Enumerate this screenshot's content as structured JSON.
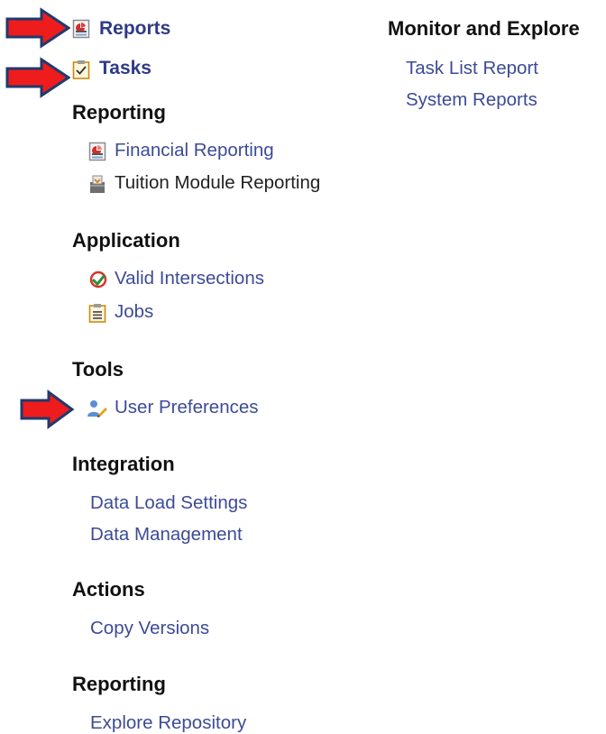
{
  "top_links": {
    "reports": "Reports",
    "tasks": "Tasks"
  },
  "sections": {
    "reporting": {
      "heading": "Reporting",
      "items": [
        "Financial Reporting",
        "Tuition Module Reporting"
      ]
    },
    "application": {
      "heading": "Application",
      "items": [
        "Valid Intersections",
        "Jobs"
      ]
    },
    "tools": {
      "heading": "Tools",
      "items": [
        "User Preferences"
      ]
    },
    "integration": {
      "heading": "Integration",
      "items": [
        "Data Load Settings",
        "Data Management"
      ]
    },
    "actions": {
      "heading": "Actions",
      "items": [
        "Copy Versions"
      ]
    },
    "reporting2": {
      "heading": "Reporting",
      "items": [
        "Explore Repository"
      ]
    },
    "monitor": {
      "heading": "Monitor and Explore",
      "items": [
        "Task List Report",
        "System Reports"
      ]
    }
  },
  "icons": {
    "reports": "report-icon",
    "tasks": "clipboard-check-icon",
    "financial_reporting": "report-icon",
    "tuition_module_reporting": "tray-inbox-icon",
    "valid_intersections": "check-circle-icon",
    "jobs": "clipboard-list-icon",
    "user_preferences": "user-edit-icon",
    "annotation_arrow": "red-arrow-icon"
  },
  "colors": {
    "link": "#3d4b96",
    "top_link": "#2f3a86",
    "heading": "#111111",
    "arrow_fill": "#ee1c1c",
    "arrow_stroke": "#1f3a6e"
  }
}
